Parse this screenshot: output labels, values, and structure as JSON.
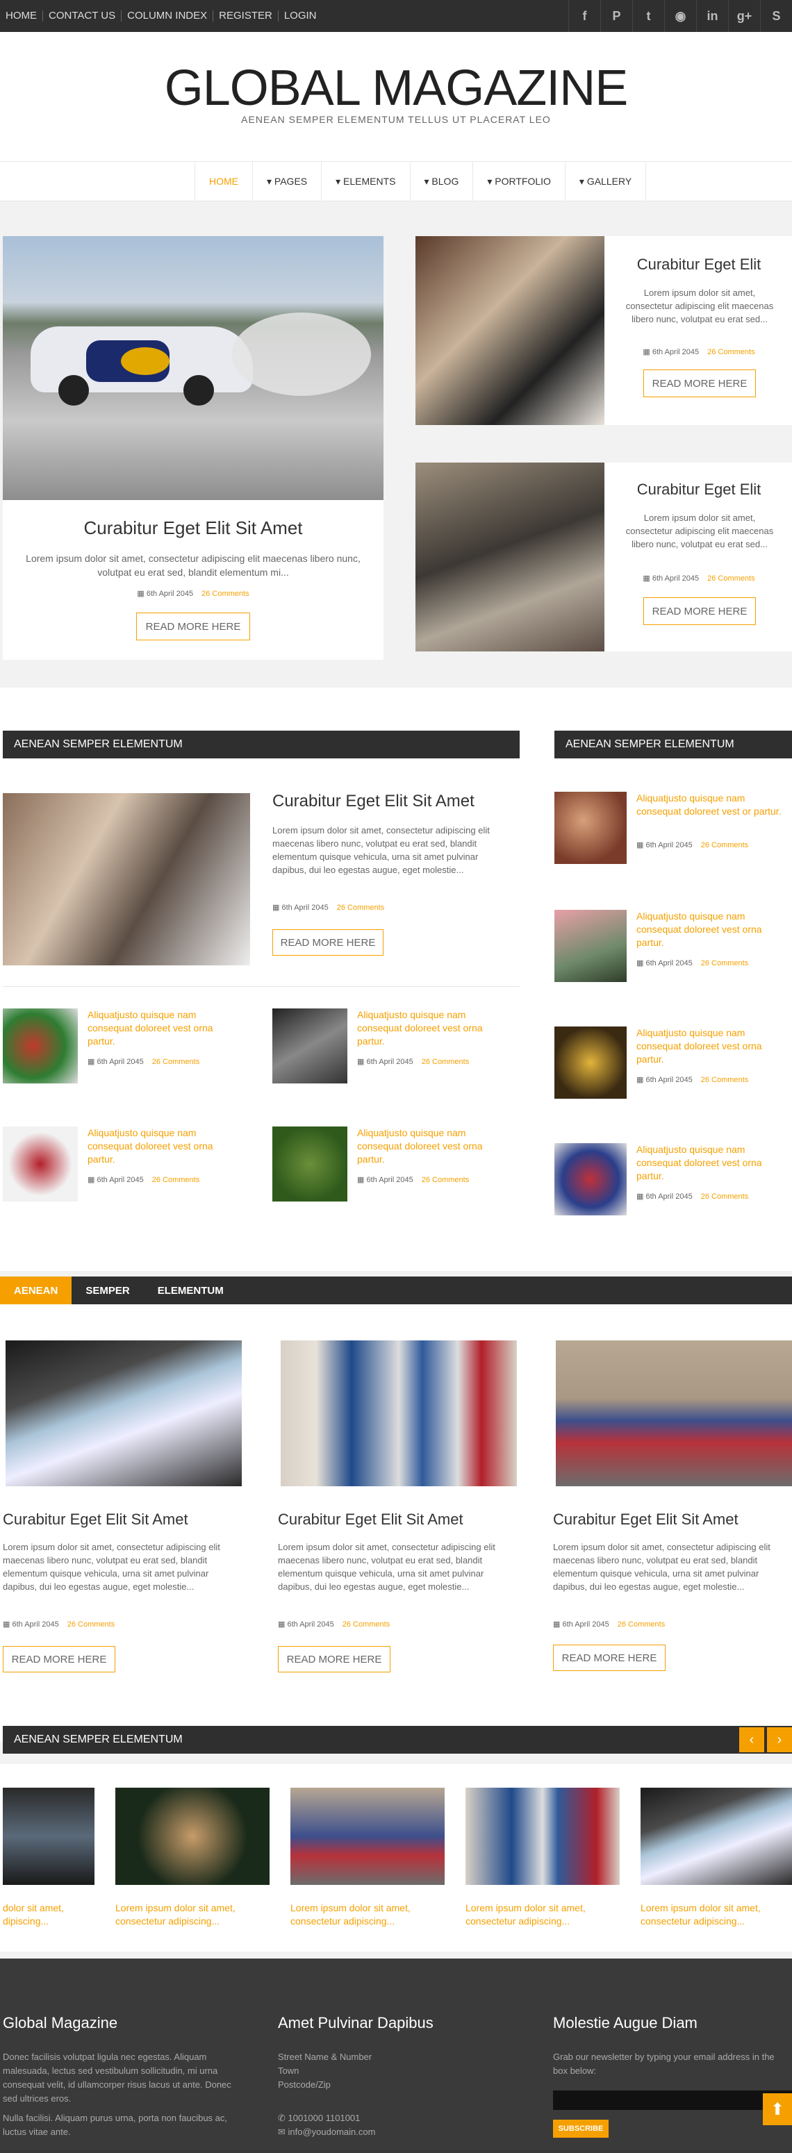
{
  "top_links": [
    "HOME",
    "CONTACT US",
    "COLUMN INDEX",
    "REGISTER",
    "LOGIN"
  ],
  "social": [
    "f",
    "P",
    "t",
    "◉",
    "in",
    "g+",
    "S"
  ],
  "site_title": "GLOBAL MAGAZINE",
  "tagline": "AENEAN SEMPER ELEMENTUM TELLUS UT PLACERAT LEO",
  "menu": [
    "HOME",
    "▾ PAGES",
    "▾ ELEMENTS",
    "▾ BLOG",
    "▾ PORTFOLIO",
    "▾ GALLERY"
  ],
  "date": "6th April 2045",
  "comments": "26 Comments",
  "read_more": "READ MORE HERE",
  "featured": {
    "title": "Curabitur Eget Elit Sit Amet",
    "excerpt": "Lorem ipsum dolor sit amet, consectetur adipiscing elit maecenas libero nunc, volutpat eu erat sed, blandit elementum mi..."
  },
  "side_posts": [
    {
      "title": "Curabitur Eget Elit",
      "excerpt": "Lorem ipsum dolor sit amet, consectetur adipiscing elit maecenas libero nunc, volutpat eu erat sed..."
    },
    {
      "title": "Curabitur Eget Elit",
      "excerpt": "Lorem ipsum dolor sit amet, consectetur adipiscing elit maecenas libero nunc, volutpat eu erat sed..."
    }
  ],
  "section1": "AENEAN SEMPER ELEMENTUM",
  "section2": "AENEAN SEMPER ELEMENTUM",
  "mid_post": {
    "title": "Curabitur Eget Elit Sit Amet",
    "excerpt": "Lorem ipsum dolor sit amet, consectetur adipiscing elit maecenas libero nunc, volutpat eu erat sed, blandit elementum quisque vehicula, urna sit amet pulvinar dapibus, dui leo egestas augue, eget molestie..."
  },
  "small_title": "Aliquatjusto quisque nam consequat doloreet vest orna partur.",
  "side_small_titles": [
    "Aliquatjusto quisque nam consequat doloreet vest or partur.",
    "Aliquatjusto quisque nam consequat doloreet vest orna partur.",
    "Aliquatjusto quisque nam consequat doloreet vest orna partur.",
    "Aliquatjusto quisque nam consequat doloreet vest orna partur."
  ],
  "tabs": [
    "AENEAN",
    "SEMPER",
    "ELEMENTUM"
  ],
  "tab_post": {
    "title": "Curabitur Eget Elit Sit Amet",
    "excerpt": "Lorem ipsum dolor sit amet, consectetur adipiscing elit maecenas libero nunc, volutpat eu erat sed, blandit elementum quisque vehicula, urna sit amet pulvinar dapibus, dui leo egestas augue, eget molestie..."
  },
  "section3": "AENEAN SEMPER ELEMENTUM",
  "carousel_first": "dolor sit amet, dipiscing...",
  "carousel_text": "Lorem ipsum dolor sit amet, consectetur adipiscing...",
  "footer": {
    "col1_title": "Global Magazine",
    "col1_text1": "Donec facilisis volutpat ligula nec egestas. Aliquam malesuada, lectus sed vestibulum sollicitudin, mi urna consequat velit, id ullamcorper risus lacus ut ante. Donec sed ultrices eros.",
    "col1_text2": "Nulla facilisi. Aliquam purus urna, porta non faucibus ac, luctus vitae ante.",
    "col2_title": "Amet Pulvinar Dapibus",
    "col2_l1": "Street Name & Number",
    "col2_l2": "Town",
    "col2_l3": "Postcode/Zip",
    "col2_phone": "1001000 1101001",
    "col2_email": "info@youdomain.com",
    "col3_title": "Molestie Augue Diam",
    "col3_text": "Grab our newsletter by typing your email address in the box below:",
    "subscribe": "SUBSCRIBE"
  },
  "colors": {
    "accent": "#f5a000",
    "dark": "#2f2f2f"
  }
}
